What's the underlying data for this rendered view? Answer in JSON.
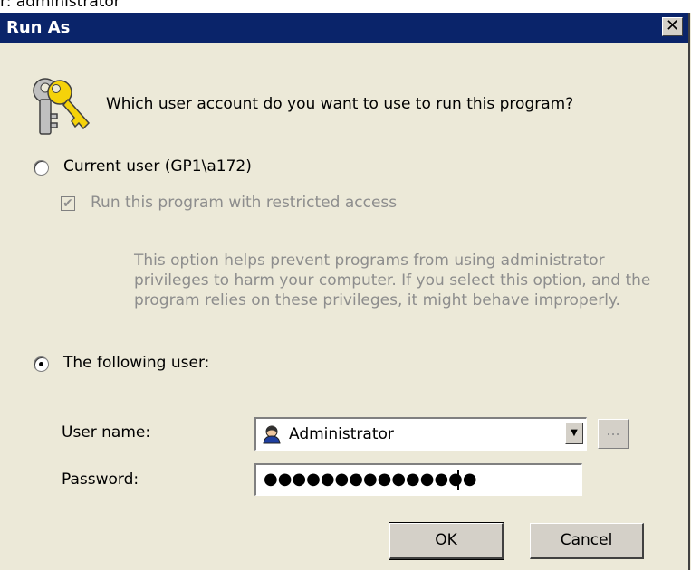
{
  "background": {
    "top_text": "r: administrator"
  },
  "dialog": {
    "title": "Run As",
    "close_glyph": "✕",
    "question": "Which user account do you want to use to run this program?",
    "current_user": {
      "label": "Current user (GP1\\a172)",
      "selected": false,
      "restricted_checkbox_label": "Run this program with restricted access",
      "restricted_checked": true,
      "description": "This option helps prevent programs from using administrator privileges to harm your computer.  If you select this option, and the program relies on these privileges, it might behave improperly."
    },
    "following_user": {
      "label": "The following user:",
      "selected": true,
      "username_label": "User name:",
      "username_value": "Administrator",
      "browse_label": "...",
      "password_label": "Password:",
      "password_mask": "●●●●●●●●●●●●●●●"
    },
    "ok_label": "OK",
    "cancel_label": "Cancel"
  },
  "icons": [
    "keys-icon",
    "user-icon",
    "dropdown-arrow-icon",
    "close-icon",
    "checkmark-icon"
  ],
  "colors": {
    "titlebar": "#0a246a",
    "dialog_bg": "#ece9d8",
    "disabled_text": "#8d8d8d"
  }
}
